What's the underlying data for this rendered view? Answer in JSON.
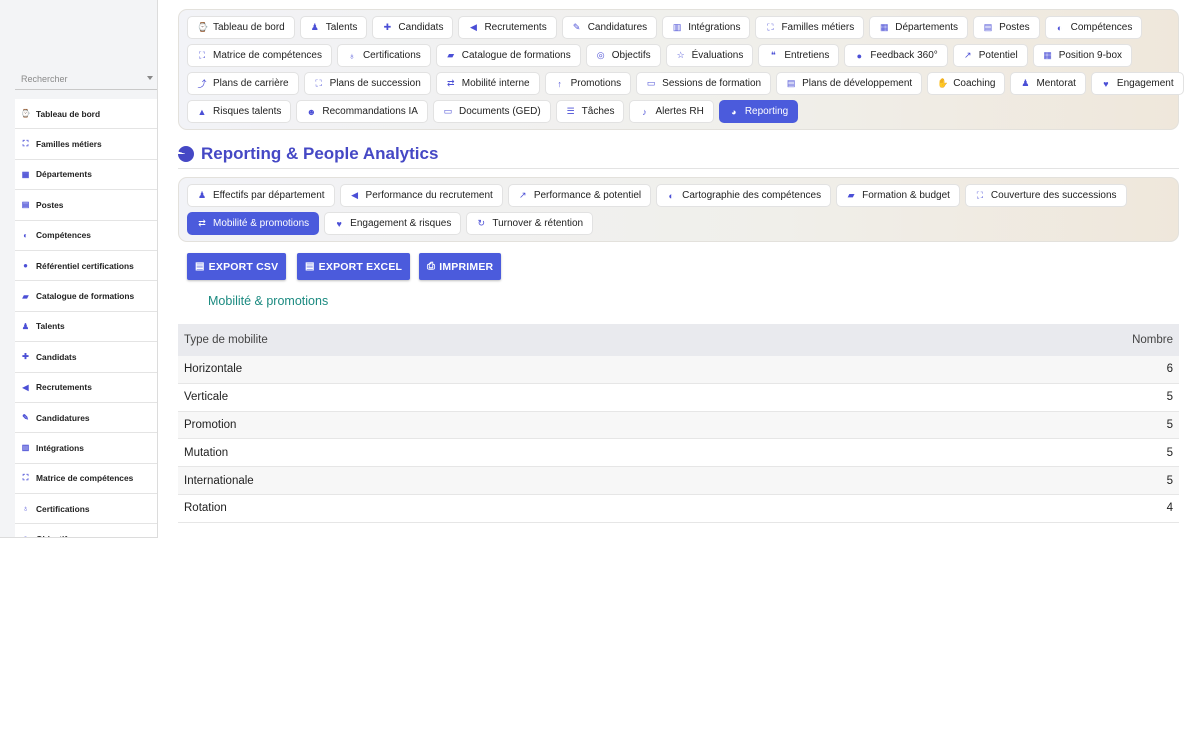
{
  "sidebar": {
    "search_placeholder": "Rechercher",
    "items": [
      {
        "label": "Tableau de bord",
        "icon": "⌚"
      },
      {
        "label": "Familles métiers",
        "icon": "⛶"
      },
      {
        "label": "Départements",
        "icon": "▦"
      },
      {
        "label": "Postes",
        "icon": "▤"
      },
      {
        "label": "Compétences",
        "icon": "◐"
      },
      {
        "label": "Référentiel certifications",
        "icon": "●"
      },
      {
        "label": "Catalogue de formations",
        "icon": "▰"
      },
      {
        "label": "Talents",
        "icon": "♟"
      },
      {
        "label": "Candidats",
        "icon": "✚"
      },
      {
        "label": "Recrutements",
        "icon": "◀"
      },
      {
        "label": "Candidatures",
        "icon": "✎"
      },
      {
        "label": "Intégrations",
        "icon": "▥"
      },
      {
        "label": "Matrice de compétences",
        "icon": "⛶"
      },
      {
        "label": "Certifications",
        "icon": "♁"
      },
      {
        "label": "Objectifs",
        "icon": "◎"
      }
    ]
  },
  "topnav": {
    "rows": [
      [
        {
          "label": "Tableau de bord",
          "icon": "⌚"
        },
        {
          "label": "Talents",
          "icon": "♟"
        },
        {
          "label": "Candidats",
          "icon": "✚"
        },
        {
          "label": "Recrutements",
          "icon": "◀"
        },
        {
          "label": "Candidatures",
          "icon": "✎"
        },
        {
          "label": "Intégrations",
          "icon": "▥"
        },
        {
          "label": "Familles métiers",
          "icon": "⛶"
        },
        {
          "label": "Départements",
          "icon": "▦"
        },
        {
          "label": "Postes",
          "icon": "▤"
        },
        {
          "label": "Compétences",
          "icon": "◐"
        }
      ],
      [
        {
          "label": "Matrice de compétences",
          "icon": "⛶"
        },
        {
          "label": "Certifications",
          "icon": "♁"
        },
        {
          "label": "Catalogue de formations",
          "icon": "▰"
        },
        {
          "label": "Objectifs",
          "icon": "◎"
        },
        {
          "label": "Évaluations",
          "icon": "☆"
        },
        {
          "label": "Entretiens",
          "icon": "❝"
        },
        {
          "label": "Feedback 360°",
          "icon": "●"
        },
        {
          "label": "Potentiel",
          "icon": "↗"
        },
        {
          "label": "Position 9-box",
          "icon": "▦"
        }
      ],
      [
        {
          "label": "Plans de carrière",
          "icon": "⤴"
        },
        {
          "label": "Plans de succession",
          "icon": "⛶"
        },
        {
          "label": "Mobilité interne",
          "icon": "⇄"
        },
        {
          "label": "Promotions",
          "icon": "↑"
        },
        {
          "label": "Sessions de formation",
          "icon": "▭"
        },
        {
          "label": "Plans de développement",
          "icon": "▤"
        },
        {
          "label": "Coaching",
          "icon": "✋"
        },
        {
          "label": "Mentorat",
          "icon": "♟"
        },
        {
          "label": "Engagement",
          "icon": "♥"
        }
      ],
      [
        {
          "label": "Risques talents",
          "icon": "▲"
        },
        {
          "label": "Recommandations IA",
          "icon": "☻"
        },
        {
          "label": "Documents (GED)",
          "icon": "▭"
        },
        {
          "label": "Tâches",
          "icon": "☰"
        },
        {
          "label": "Alertes RH",
          "icon": "♪"
        },
        {
          "label": "Reporting",
          "icon": "◕",
          "active": true
        }
      ]
    ]
  },
  "page": {
    "title": "Reporting & People Analytics"
  },
  "subnav": {
    "rows": [
      [
        {
          "label": "Effectifs par département",
          "icon": "♟"
        },
        {
          "label": "Performance du recrutement",
          "icon": "◀"
        },
        {
          "label": "Performance & potentiel",
          "icon": "↗"
        },
        {
          "label": "Cartographie des compétences",
          "icon": "◐"
        },
        {
          "label": "Formation & budget",
          "icon": "▰"
        },
        {
          "label": "Couverture des successions",
          "icon": "⛶"
        }
      ],
      [
        {
          "label": "Mobilité & promotions",
          "icon": "⇄",
          "active": true
        },
        {
          "label": "Engagement & risques",
          "icon": "♥"
        },
        {
          "label": "Turnover & rétention",
          "icon": "↻"
        }
      ]
    ]
  },
  "actions": {
    "export_csv": "EXPORT CSV",
    "export_excel": "EXPORT EXCEL",
    "print": "IMPRIMER"
  },
  "report": {
    "section_title": "Mobilité & promotions",
    "columns": [
      "Type de mobilite",
      "Nombre"
    ],
    "rows": [
      [
        "Horizontale",
        "6"
      ],
      [
        "Verticale",
        "5"
      ],
      [
        "Promotion",
        "5"
      ],
      [
        "Mutation",
        "5"
      ],
      [
        "Internationale",
        "5"
      ],
      [
        "Rotation",
        "4"
      ]
    ]
  }
}
